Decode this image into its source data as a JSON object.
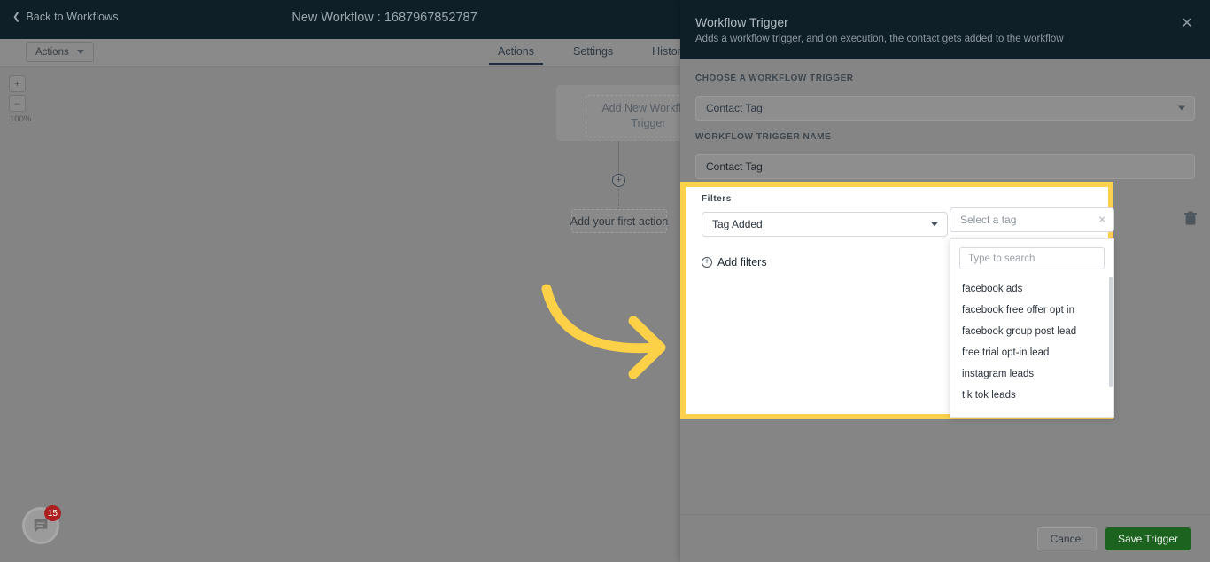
{
  "builder": {
    "back_link": "Back to Workflows",
    "back_chevron": "chevron-left-icon",
    "workflow_title": "New Workflow : 1687967852787",
    "actions_button": "Actions",
    "tabs": [
      {
        "label": "Actions",
        "active": true
      },
      {
        "label": "Settings",
        "active": false
      },
      {
        "label": "History",
        "active": false
      }
    ],
    "zoom": {
      "zoom_in": "+",
      "zoom_out": "–",
      "level": "100%"
    },
    "flow": {
      "trigger_node": "Add New Workflow Trigger",
      "add_node_icon": "plus-circle-icon",
      "first_action": "Add your first action"
    },
    "chat": {
      "icon": "chat-bubble-icon",
      "badge_count": "15"
    },
    "annotation": {
      "type": "curved-arrow",
      "color": "#fcd147"
    }
  },
  "panel": {
    "title": "Workflow Trigger",
    "subtitle": "Adds a workflow trigger, and on execution, the contact gets added to the workflow",
    "close_icon": "close-icon",
    "choose_trigger_label": "Choose a workflow trigger",
    "choose_trigger_value": "Contact Tag",
    "trigger_name_label": "Workflow Trigger Name",
    "trigger_name_value": "Contact Tag",
    "filters": {
      "label": "Filters",
      "condition_value": "Tag Added",
      "add_filters_label": "Add filters",
      "add_filters_icon": "plus-circle-icon",
      "delete_icon": "trash-icon",
      "highlight_color": "#fdd14e"
    },
    "tag_select": {
      "placeholder": "Select a tag",
      "clear_icon": "clear-icon",
      "search_placeholder": "Type to search",
      "options": [
        "facebook ads",
        "facebook free offer opt in",
        "facebook group post lead",
        "free trial opt-in lead",
        "instagram leads",
        "tik tok leads"
      ]
    },
    "footer": {
      "cancel_label": "Cancel",
      "save_label": "Save Trigger",
      "save_color": "#1c6320"
    }
  }
}
